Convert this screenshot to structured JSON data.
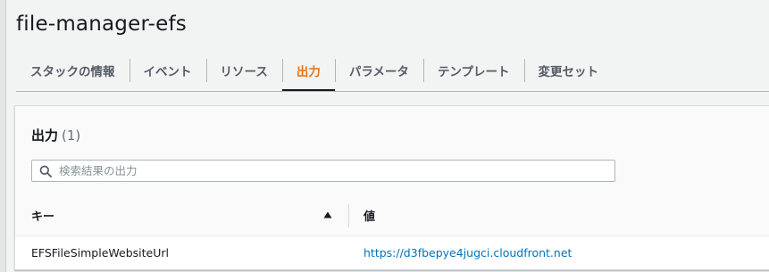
{
  "page": {
    "title": "file-manager-efs"
  },
  "tabs": [
    {
      "label": "スタックの情報",
      "active": false
    },
    {
      "label": "イベント",
      "active": false
    },
    {
      "label": "リソース",
      "active": false
    },
    {
      "label": "出力",
      "active": true
    },
    {
      "label": "パラメータ",
      "active": false
    },
    {
      "label": "テンプレート",
      "active": false
    },
    {
      "label": "変更セット",
      "active": false
    }
  ],
  "outputs_panel": {
    "title": "出力",
    "count": "(1)",
    "search": {
      "placeholder": "検索結果の出力",
      "value": "",
      "icon": "search-icon"
    },
    "columns": {
      "key": "キー",
      "value": "値",
      "sort_icon": "caret-up-icon"
    },
    "rows": [
      {
        "key": "EFSFileSimpleWebsiteUrl",
        "value": "https://d3fbepye4jugci.cloudfront.net"
      }
    ]
  },
  "colors": {
    "active_tab": "#ec7211",
    "link": "#0073bb",
    "text": "#16191f",
    "muted": "#545b64"
  }
}
